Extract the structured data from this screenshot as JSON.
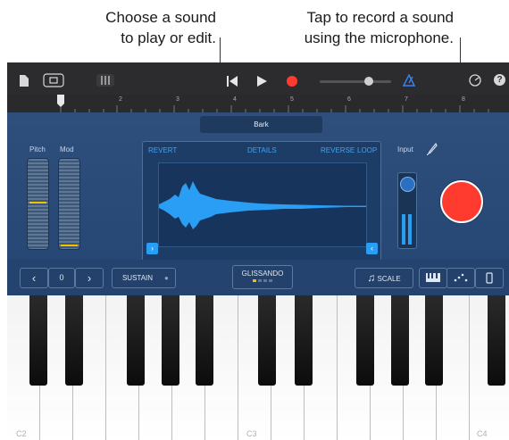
{
  "callouts": {
    "sound_select": "Choose a sound\nto play or edit.",
    "record": "Tap to record a sound\nusing the microphone."
  },
  "toolbar": {
    "icons": [
      "document-icon",
      "view-toggle-icon",
      "mixer-icon",
      "rewind-icon",
      "play-icon",
      "record-icon",
      "volume-slider",
      "metronome-icon",
      "settings-icon",
      "help-icon"
    ],
    "accent": "#3b82f6",
    "record_color": "#ff3b30"
  },
  "ruler": {
    "marks": [
      "1",
      "2",
      "3",
      "4",
      "5",
      "6",
      "7",
      "8"
    ]
  },
  "sound_name": "Bark",
  "controls": {
    "pitch_label": "Pitch",
    "mod_label": "Mod",
    "input_label": "Input"
  },
  "waveform": {
    "revert_label": "REVERT",
    "details_label": "DETAILS",
    "reverse_label": "REVERSE",
    "loop_label": "LOOP"
  },
  "bottom_bar": {
    "octave_value": "0",
    "sustain_label": "SUSTAIN",
    "glissando_label": "GLISSANDO",
    "scale_label": "SCALE"
  },
  "keyboard": {
    "labels": [
      "C2",
      "C3",
      "C4"
    ]
  }
}
